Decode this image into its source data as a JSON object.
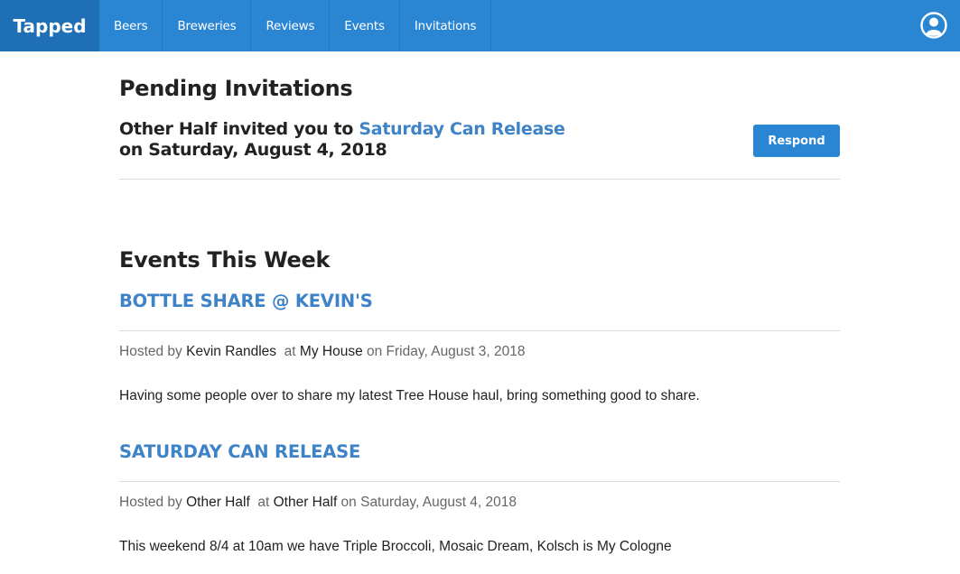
{
  "app": {
    "brand": "Tapped"
  },
  "nav": {
    "items": [
      {
        "label": "Beers"
      },
      {
        "label": "Breweries"
      },
      {
        "label": "Reviews"
      },
      {
        "label": "Events"
      },
      {
        "label": "Invitations"
      }
    ],
    "avatar_icon": "user-circle-icon"
  },
  "pending": {
    "title": "Pending Invitations",
    "invitation": {
      "inviter": "Other Half",
      "phrase": " invited you to ",
      "event": "Saturday Can Release",
      "date_line": "on Saturday, August 4, 2018",
      "button": "Respond"
    }
  },
  "events_week": {
    "title": "Events This Week",
    "events": [
      {
        "title": "BOTTLE SHARE @ KEVIN'S",
        "hosted_prefix": "Hosted by ",
        "host": "Kevin Randles",
        "at_prefix": "  at ",
        "location": "My House",
        "date": " on Friday, August 3, 2018",
        "description": "Having some people over to share my latest Tree House haul, bring something good to share."
      },
      {
        "title": "SATURDAY CAN RELEASE",
        "hosted_prefix": "Hosted by ",
        "host": "Other Half",
        "at_prefix": "  at ",
        "location": "Other Half",
        "date": " on Saturday, August 4, 2018",
        "description": "This weekend 8/4 at 10am we have Triple Broccoli, Mosaic Dream, Kolsch is My Cologne"
      }
    ]
  },
  "colors": {
    "nav": "#2a85d3",
    "brand_bg": "#1f6fb6",
    "link": "#3e82c7"
  }
}
